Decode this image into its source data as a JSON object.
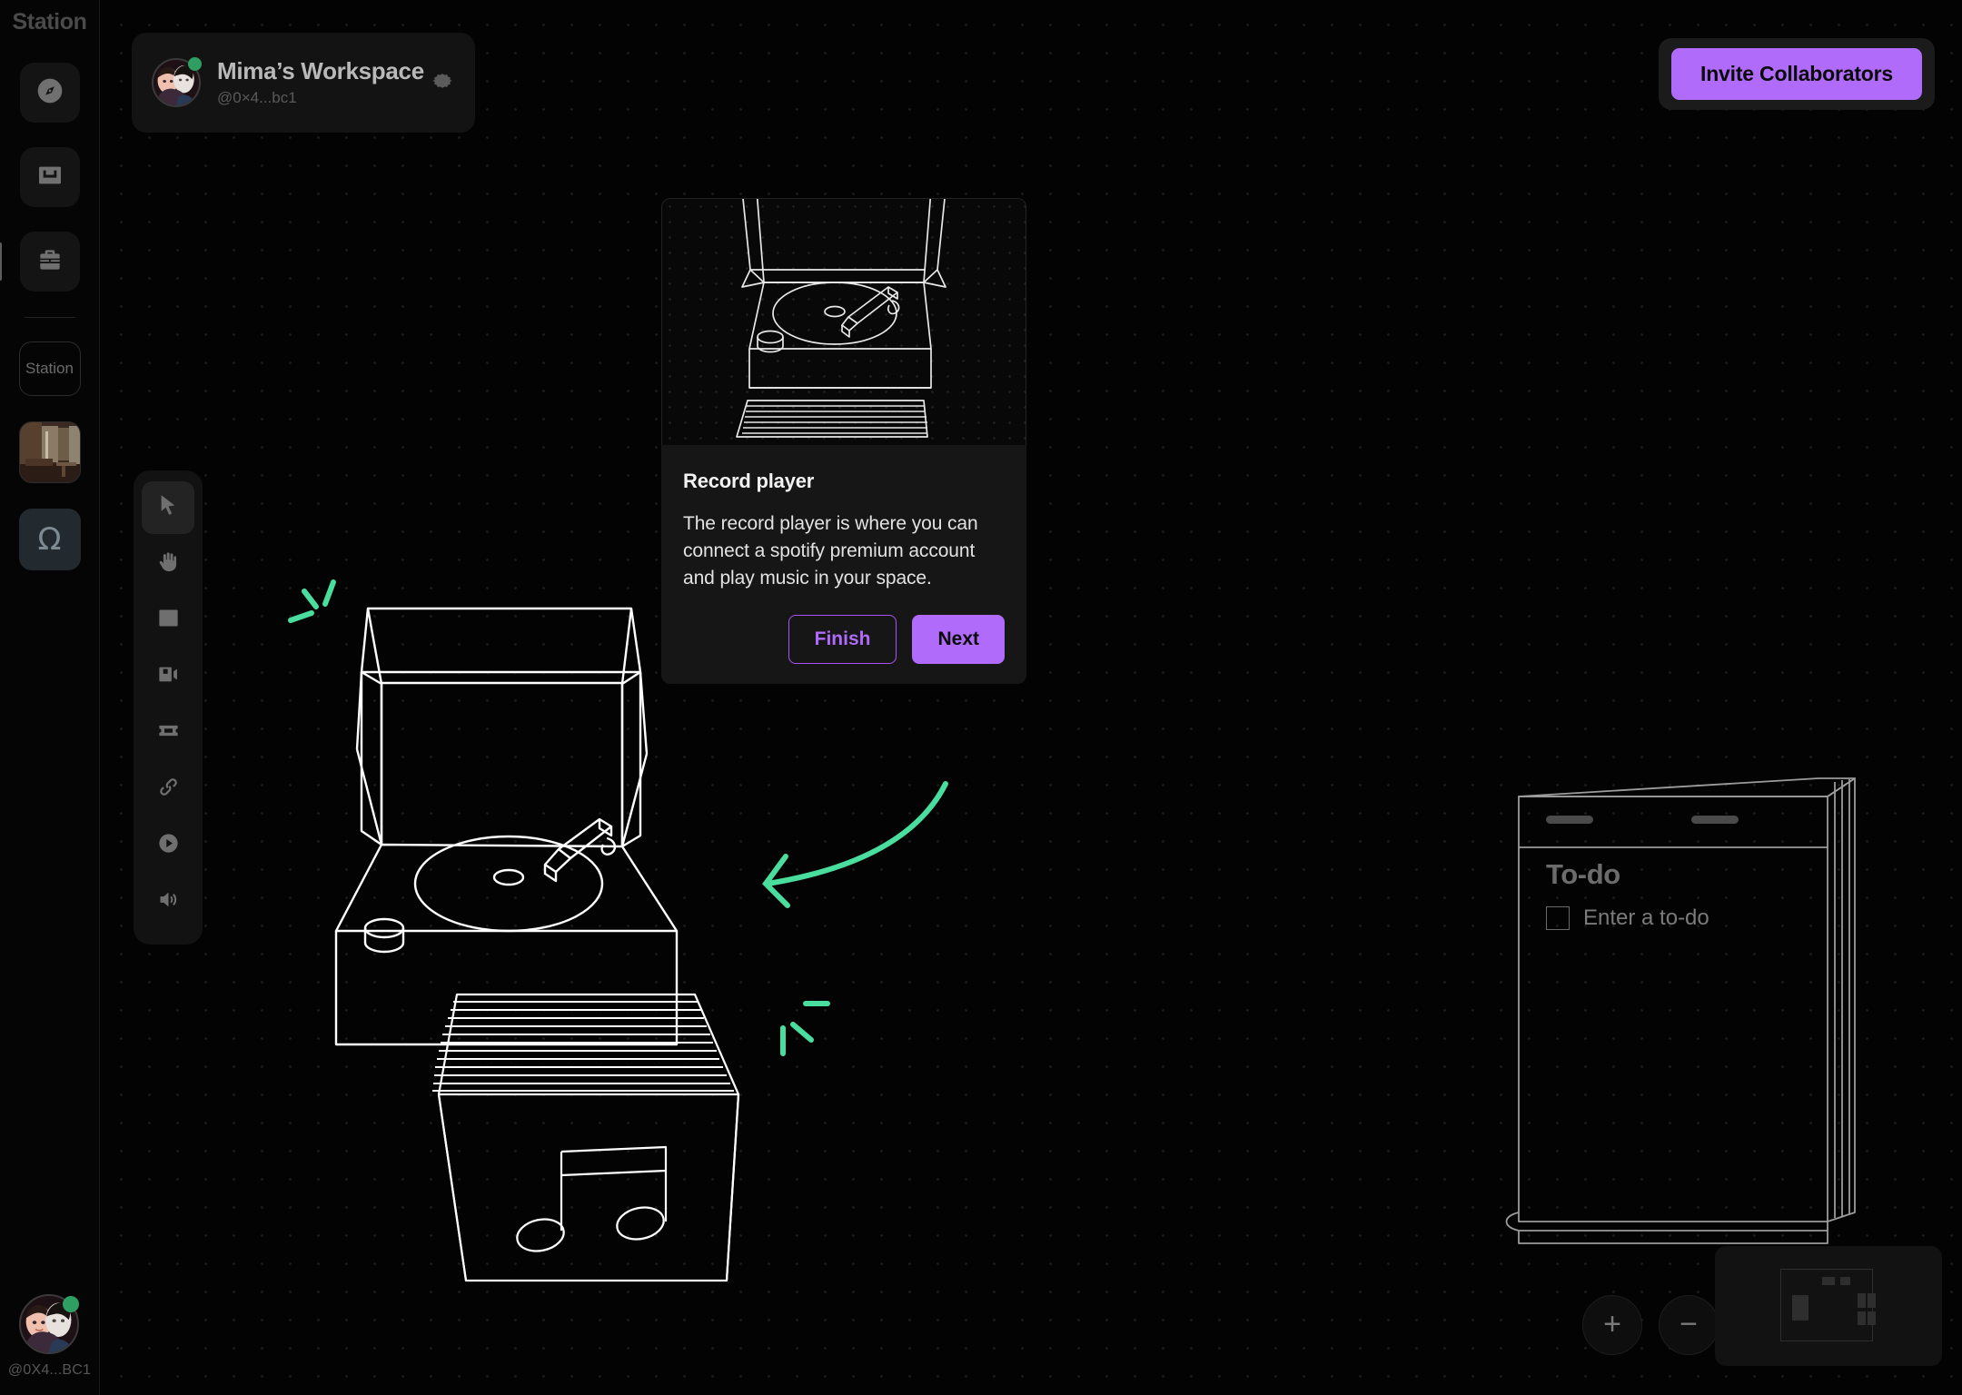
{
  "app": {
    "rail_title": "Station",
    "background": "#030303",
    "accent": "#b06bfa",
    "accent_green": "#4ade9e"
  },
  "rail": {
    "title": "Station",
    "items": [
      {
        "name": "explore",
        "icon": "compass-icon",
        "label": ""
      },
      {
        "name": "inbox",
        "icon": "inbox-icon",
        "label": ""
      },
      {
        "name": "workspace",
        "icon": "briefcase-icon",
        "label": "",
        "active": true
      }
    ],
    "chip_label": "Station",
    "room_thumbnail": "room-thumbnail",
    "omega_label": "Ω",
    "user_handle": "@0X4...BC1"
  },
  "workspace_card": {
    "name": "Mima’s Workspace",
    "handle": "@0×4...bc1",
    "settings_icon": "gear-icon",
    "status": "online"
  },
  "header": {
    "invite_label": "Invite Collaborators"
  },
  "toolbar": {
    "tools": [
      {
        "name": "select-tool",
        "icon": "cursor-icon",
        "active": true
      },
      {
        "name": "pan-tool",
        "icon": "hand-icon",
        "active": false
      },
      {
        "name": "image-tool",
        "icon": "image-icon",
        "active": false
      },
      {
        "name": "video-tool",
        "icon": "video-icon",
        "active": false
      },
      {
        "name": "ticket-tool",
        "icon": "ticket-icon",
        "active": false
      },
      {
        "name": "link-tool",
        "icon": "link-icon",
        "active": false
      },
      {
        "name": "play-tool",
        "icon": "play-circle-icon",
        "active": false
      },
      {
        "name": "audio-tool",
        "icon": "speaker-icon",
        "active": false
      }
    ]
  },
  "tooltip": {
    "title": "Record player",
    "description": "The record player is where you can connect a spotify premium account and play music in your space.",
    "preview_alt": "record-player-illustration",
    "finish_label": "Finish",
    "next_label": "Next"
  },
  "todo_widget": {
    "title": "To-do",
    "placeholder": "Enter a to-do",
    "checkbox_checked": false
  },
  "canvas_controls": {
    "zoom_in_label": "+",
    "zoom_out_label": "−",
    "minimap": "minimap"
  },
  "canvas_objects": [
    {
      "name": "record-player",
      "type": "illustration"
    },
    {
      "name": "record-crate",
      "type": "illustration"
    },
    {
      "name": "dresser-todo",
      "type": "widget"
    },
    {
      "name": "pointer-arrow",
      "type": "annotation",
      "color": "#4ade9e"
    },
    {
      "name": "sparkle-top",
      "type": "annotation",
      "color": "#4ade9e"
    },
    {
      "name": "sparkle-bottom",
      "type": "annotation",
      "color": "#4ade9e"
    }
  ]
}
